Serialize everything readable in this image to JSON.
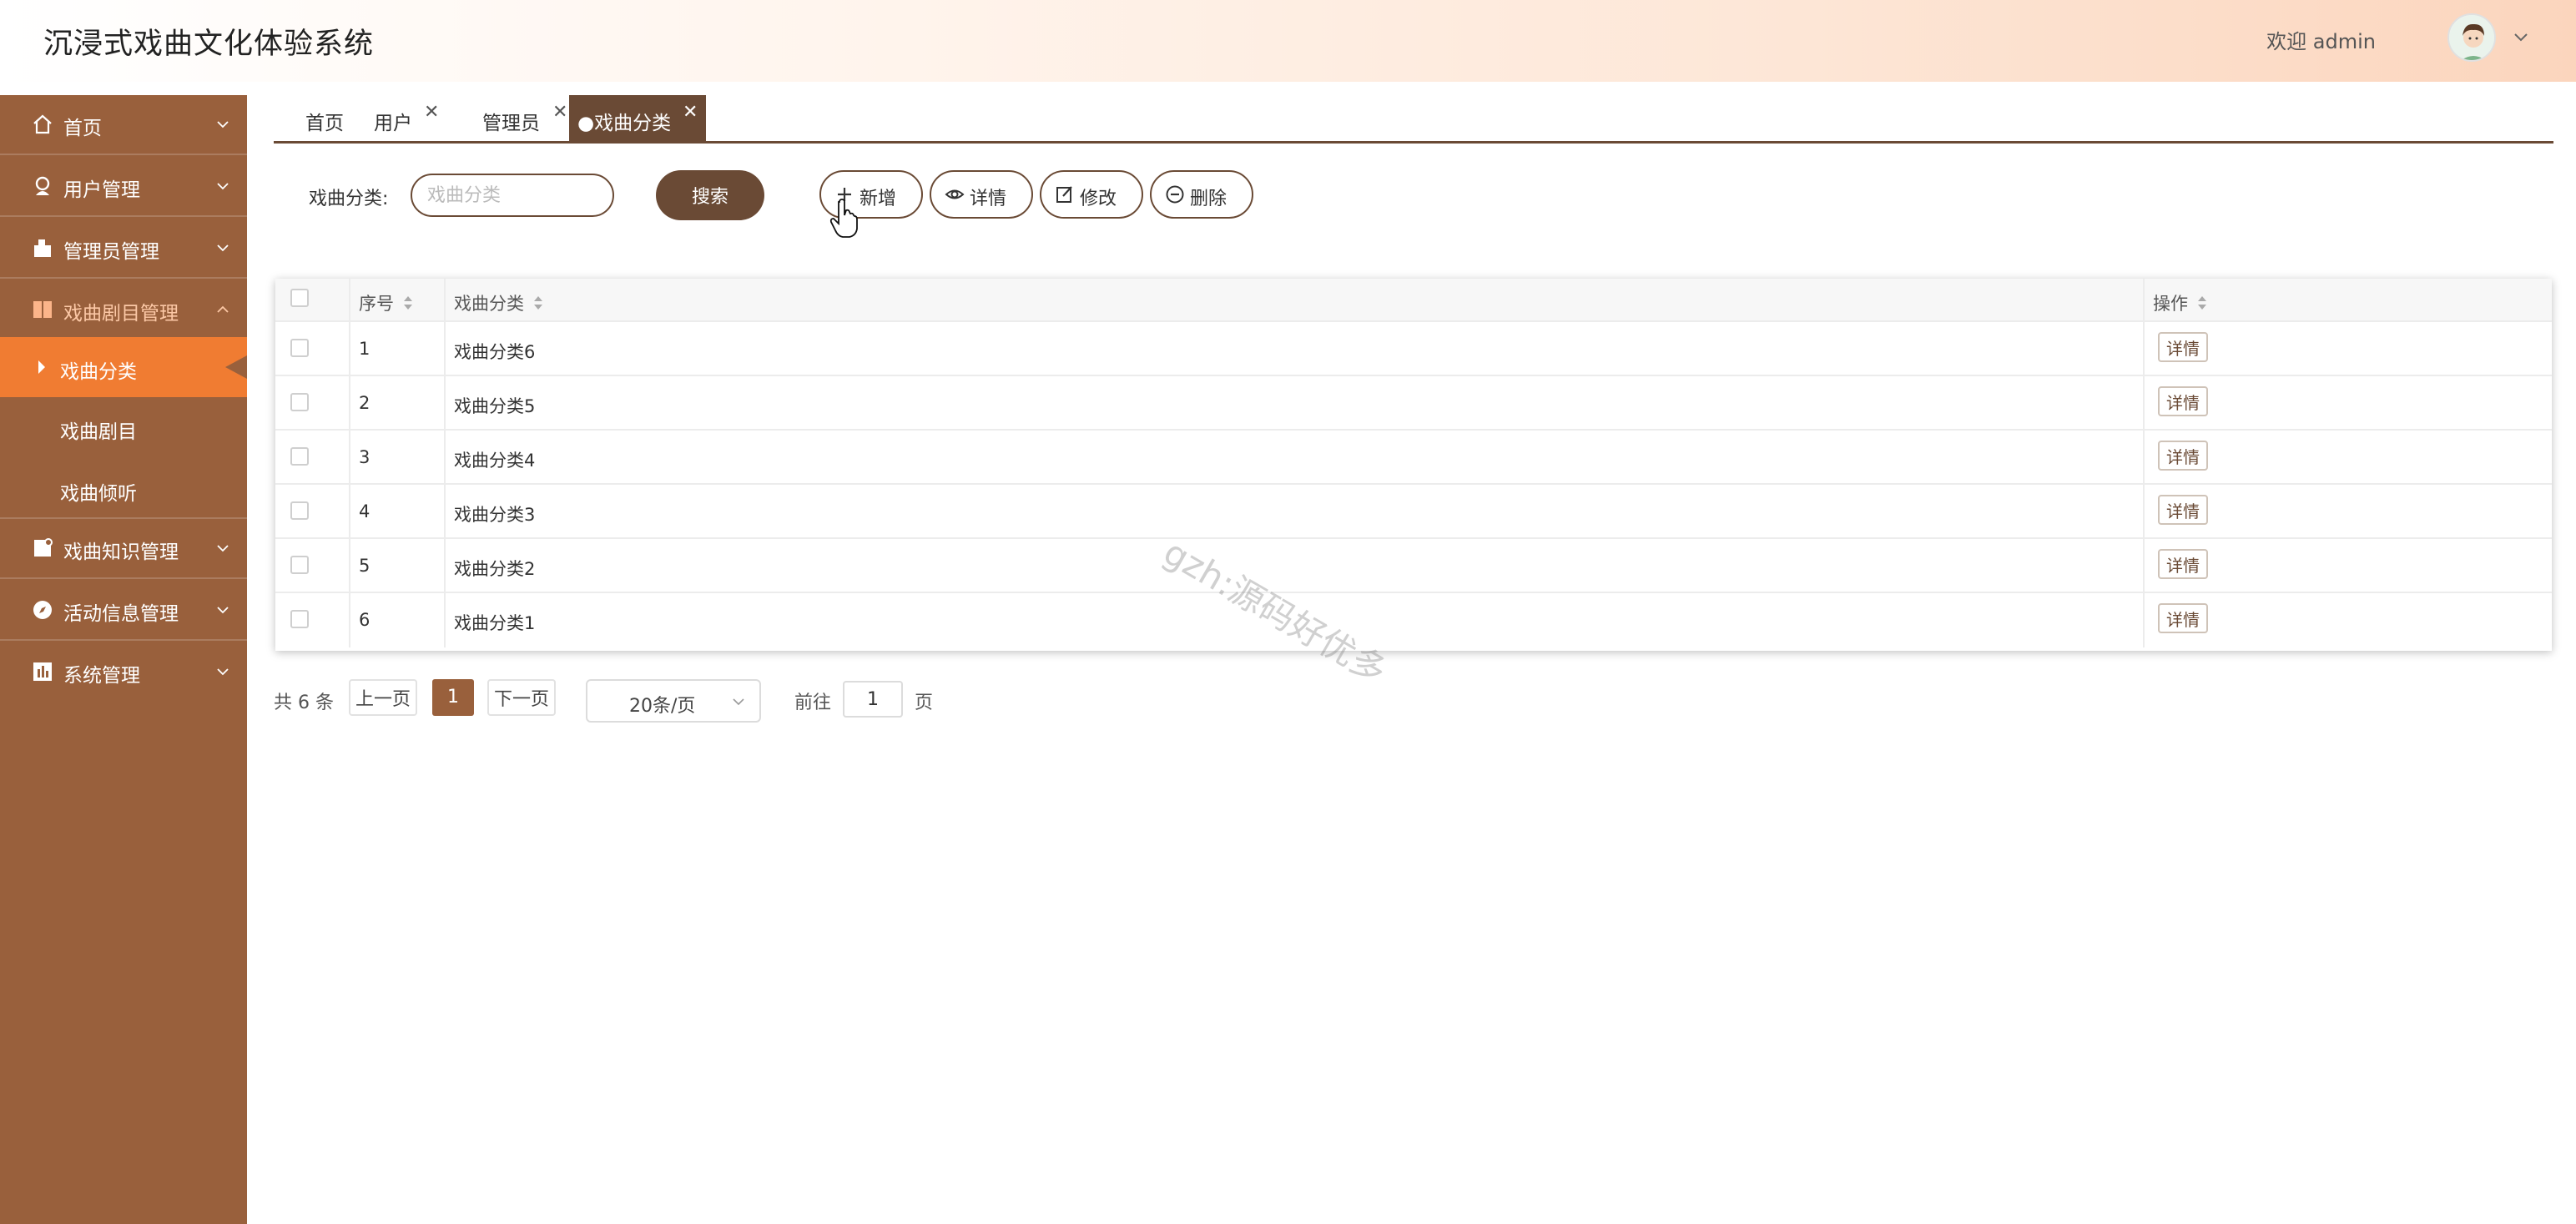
{
  "header": {
    "title": "沉浸式戏曲文化体验系统",
    "welcome": "欢迎 admin"
  },
  "sidebar": {
    "items": [
      {
        "label": "首页",
        "icon": "home-icon"
      },
      {
        "label": "用户管理",
        "icon": "user-icon"
      },
      {
        "label": "管理员管理",
        "icon": "admin-icon"
      },
      {
        "label": "戏曲剧目管理",
        "icon": "book-icon",
        "expanded": true,
        "children": [
          {
            "label": "戏曲分类",
            "active": true
          },
          {
            "label": "戏曲剧目"
          },
          {
            "label": "戏曲倾听"
          }
        ]
      },
      {
        "label": "戏曲知识管理",
        "icon": "note-icon"
      },
      {
        "label": "活动信息管理",
        "icon": "compass-icon"
      },
      {
        "label": "系统管理",
        "icon": "chart-icon"
      }
    ]
  },
  "tabs": [
    {
      "label": "首页",
      "closable": false
    },
    {
      "label": "用户",
      "closable": true
    },
    {
      "label": "管理员",
      "closable": true
    },
    {
      "label": "●戏曲分类",
      "closable": true,
      "active": true
    }
  ],
  "search": {
    "label": "戏曲分类:",
    "placeholder": "戏曲分类",
    "button": "搜索"
  },
  "actions": {
    "add": "新增",
    "detail": "详情",
    "edit": "修改",
    "delete": "删除"
  },
  "table": {
    "columns": [
      "序号",
      "戏曲分类",
      "操作"
    ],
    "rows": [
      {
        "index": "1",
        "category": "戏曲分类6",
        "action": "详情"
      },
      {
        "index": "2",
        "category": "戏曲分类5",
        "action": "详情"
      },
      {
        "index": "3",
        "category": "戏曲分类4",
        "action": "详情"
      },
      {
        "index": "4",
        "category": "戏曲分类3",
        "action": "详情"
      },
      {
        "index": "5",
        "category": "戏曲分类2",
        "action": "详情"
      },
      {
        "index": "6",
        "category": "戏曲分类1",
        "action": "详情"
      }
    ]
  },
  "pagination": {
    "total": "共 6 条",
    "prev": "上一页",
    "current": "1",
    "next": "下一页",
    "page_size": "20条/页",
    "goto": "前往",
    "goto_value": "1",
    "page_suffix": "页"
  },
  "watermark": "gzh:源码好优多",
  "colors": {
    "sidebar_bg": "#99603c",
    "active_menu": "#f07c32",
    "accent": "#6a4a35"
  }
}
